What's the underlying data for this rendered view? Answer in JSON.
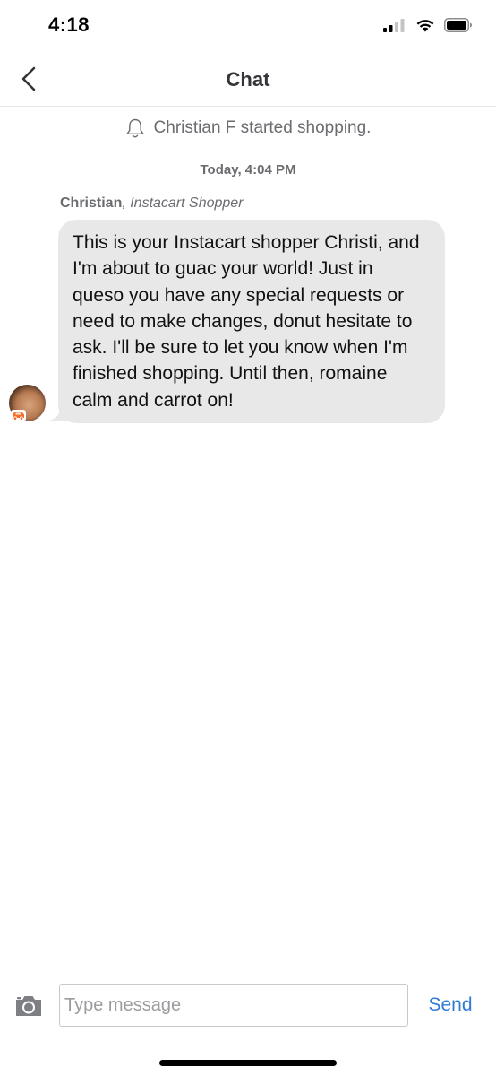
{
  "status_bar": {
    "time": "4:18",
    "icons": [
      "cellular-signal-icon",
      "wifi-icon",
      "battery-icon"
    ]
  },
  "nav": {
    "title": "Chat",
    "back_icon": "chevron-left-icon"
  },
  "chat": {
    "system_notice": "Christian F started shopping.",
    "system_notice_icon": "bell-icon",
    "timestamp": "Today, 4:04 PM",
    "messages": [
      {
        "sender_name": "Christian",
        "sender_separator": ", ",
        "sender_role": "Instacart Shopper",
        "text": "This is your Instacart shopper Christi, and I'm about to guac your world! Just in queso you have any special requests or need to make changes, donut hesitate to ask. I'll be sure to let you know when I'm finished shopping. Until then, romaine calm and carrot on!",
        "avatar_badge_icon": "delivery-car-icon"
      }
    ]
  },
  "composer": {
    "camera_icon": "camera-icon",
    "placeholder": "Type message",
    "value": "",
    "send_label": "Send"
  },
  "colors": {
    "accent": "#2f7bd9",
    "bubble": "#e8e8e9",
    "badge": "#f36d2b",
    "secondary_text": "#6a6c70"
  }
}
